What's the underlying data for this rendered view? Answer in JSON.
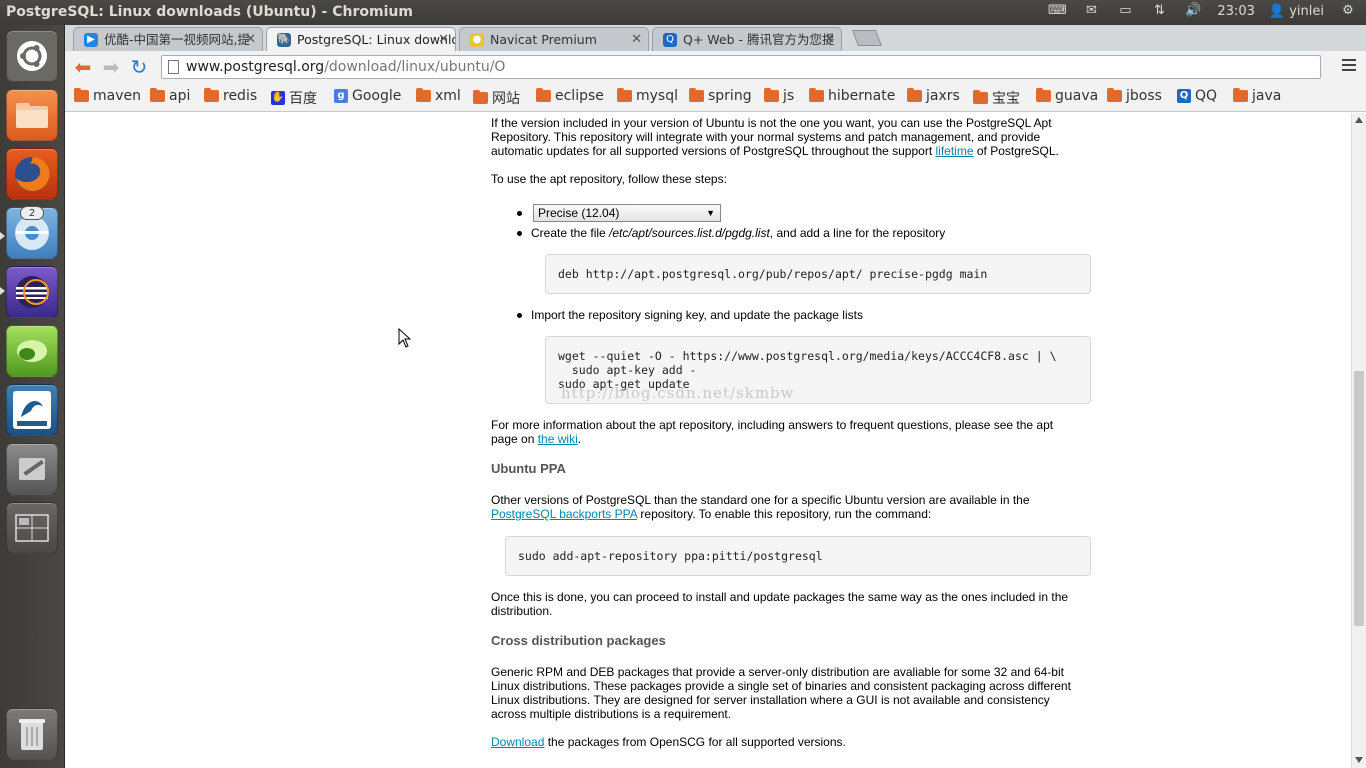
{
  "window": {
    "title": "PostgreSQL: Linux downloads (Ubuntu) - Chromium"
  },
  "panel": {
    "time": "23:03",
    "user": "yinlei"
  },
  "launcher": {
    "badge_count": "2"
  },
  "tabs": [
    {
      "label": "优酷-中国第一视频网站,提",
      "active": false
    },
    {
      "label": "PostgreSQL: Linux downlo",
      "active": true
    },
    {
      "label": "Navicat Premium",
      "active": false
    },
    {
      "label": "Q+ Web - 腾讯官方为您提",
      "active": false
    }
  ],
  "address": {
    "host": "www.postgresql.org",
    "path": "/download/linux/ubuntu/O"
  },
  "bookmarks": [
    "maven",
    "api",
    "redis",
    "百度",
    "Google",
    "xml",
    "网站",
    "eclipse",
    "mysql",
    "spring",
    "js",
    "hibernate",
    "jaxrs",
    "宝宝",
    "guava",
    "jboss",
    "QQ",
    "java"
  ],
  "page": {
    "intro_1": "If the version included in your version of Ubuntu is not the one you want, you can use the PostgreSQL Apt",
    "intro_2": "Repository. This repository will integrate with your normal systems and patch management, and provide",
    "intro_3a": "automatic updates for all supported versions of PostgreSQL throughout the support ",
    "intro_3_link": "lifetime",
    "intro_3b": " of PostgreSQL.",
    "steps_intro": "To use the apt repository, follow these steps:",
    "release_select": "Precise (12.04)",
    "create_file_a": "Create the file ",
    "create_file_path": "/etc/apt/sources.list.d/pgdg.list",
    "create_file_b": ", and add a line for the repository",
    "code_repo": "deb http://apt.postgresql.org/pub/repos/apt/ precise-pgdg main",
    "import_key": "Import the repository signing key, and update the package lists",
    "code_key_1": "wget --quiet -O - https://www.postgresql.org/media/keys/ACCC4CF8.asc | \\",
    "code_key_2": "  sudo apt-key add -",
    "code_key_3": "sudo apt-get update",
    "watermark": "http://blog.csdn.net/skmbw",
    "more_info_1": "For more information about the apt repository, including answers to frequent questions, please see the apt",
    "more_info_2a": "page on ",
    "more_info_link": "the wiki",
    "more_info_2b": ".",
    "ppa_heading": "Ubuntu PPA",
    "ppa_1": "Other versions of PostgreSQL than the standard one for a specific Ubuntu version are available in the",
    "ppa_link": "PostgreSQL backports PPA",
    "ppa_2": " repository. To enable this repository, run the command:",
    "code_ppa": "sudo add-apt-repository ppa:pitti/postgresql",
    "done_1": "Once this is done, you can proceed to install and update packages the same way as the ones included in the",
    "done_2": "distribution.",
    "cross_heading": "Cross distribution packages",
    "cross_1": "Generic RPM and DEB packages that provide a server-only distribution are avaliable for some 32 and 64-bit",
    "cross_2": "Linux distributions. These packages provide a single set of binaries and consistent packaging across different",
    "cross_3": "Linux distributions. They are designed for server installation where a GUI is not available and consistency",
    "cross_4": "across multiple distributions is a requirement.",
    "download_link": "Download",
    "download_text": " the packages from OpenSCG for all supported versions."
  }
}
